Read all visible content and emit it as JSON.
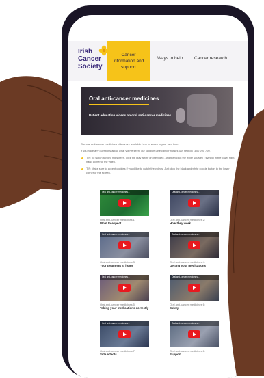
{
  "brand": {
    "logo_lines": [
      "Irish",
      "Cancer",
      "Society"
    ],
    "logo_color": "#3b2a7a",
    "accent": "#f6c319"
  },
  "nav": {
    "active_lines": [
      "Cancer",
      "information and",
      "support"
    ],
    "ways": "Ways to help",
    "research": "Cancer research"
  },
  "hero": {
    "title": "Oral anti-cancer medicines",
    "subtitle": "Patient education videos on oral anti-cancer medicines"
  },
  "intro": {
    "p1": "Our oral anti-cancer medicines videos are available here to watch in your own time.",
    "p2": "If you have any questions about what you've seen, our Support Line cancer nurses can help on 1800 200 700.",
    "tip1": "TIP: To watch a video full screen, click the play arrow on the video, and then click the white square [ ] symbol in the lower right-hand corner of the video.",
    "tip2": "TIP: Make sure to accept cookies if you'd like to watch the videos. Just click the black and white cookie button in the lower corner of the screen."
  },
  "videos": [
    {
      "thumb": "Oral anti-cancer medicines...",
      "num": "Oral anti-cancer medicines 1:",
      "title": "What to expect"
    },
    {
      "thumb": "Oral anti-cancer medicines...",
      "num": "Oral anti-cancer medicines 2:",
      "title": "How they work"
    },
    {
      "thumb": "Oral anti-cancer medicines...",
      "num": "Oral anti-cancer medicines 3:",
      "title": "Your treatment at home"
    },
    {
      "thumb": "Oral anti-cancer medicines...",
      "num": "Oral anti-cancer medicines 4:",
      "title": "Getting your medications"
    },
    {
      "thumb": "Oral anti-cancer medicines...",
      "num": "Oral anti-cancer medicines 5:",
      "title": "Taking your medications correctly"
    },
    {
      "thumb": "Oral anti-cancer medicines...",
      "num": "Oral anti-cancer medicines 6:",
      "title": "Safety"
    },
    {
      "thumb": "Oral anti-cancer medicines...",
      "num": "Oral anti-cancer medicines 7:",
      "title": "Side effects"
    },
    {
      "thumb": "Oral anti-cancer medicines...",
      "num": "Oral anti-cancer medicines 8:",
      "title": "Support"
    }
  ],
  "colors": {
    "phone_frame": "#1a1526",
    "play_button": "#e8191f",
    "skin": "#6b3a24"
  }
}
